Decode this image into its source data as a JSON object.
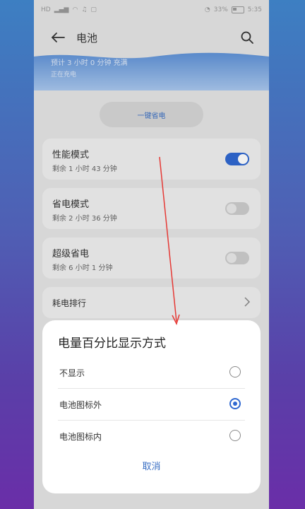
{
  "status_bar": {
    "carrier": "HD",
    "battery_pct": "33%",
    "time": "5:35"
  },
  "header": {
    "title": "电池"
  },
  "battery_panel": {
    "charge_time": "预计 3 小时 0 分钟 充满",
    "state": "正在充电"
  },
  "one_tap_save_label": "一键省电",
  "modes": [
    {
      "title": "性能模式",
      "remaining": "剩余 1 小时 43 分钟",
      "enabled": true
    },
    {
      "title": "省电模式",
      "remaining": "剩余 2 小时 36 分钟",
      "enabled": false
    },
    {
      "title": "超级省电",
      "remaining": "剩余 6 小时 1 分钟",
      "enabled": false
    }
  ],
  "power_rank_label": "耗电排行",
  "dialog": {
    "title": "电量百分比显示方式",
    "options": [
      {
        "label": "不显示",
        "selected": false
      },
      {
        "label": "电池图标外",
        "selected": true
      },
      {
        "label": "电池图标内",
        "selected": false
      }
    ],
    "cancel_label": "取消"
  },
  "colors": {
    "accent": "#2f68d1",
    "annotation_arrow": "#e53935"
  }
}
